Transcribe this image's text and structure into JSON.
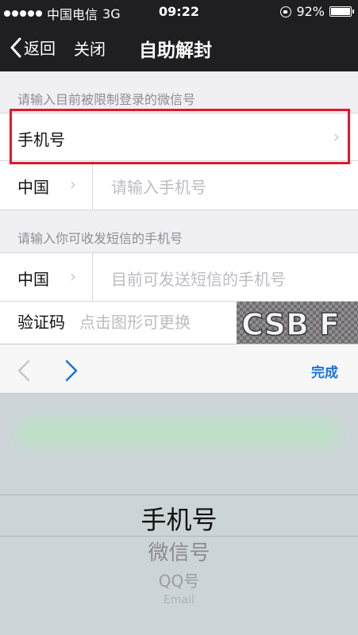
{
  "status_bar": {
    "carrier": "中国电信",
    "network": "3G",
    "time": "09:22",
    "battery": "92%",
    "battery_level": 0.92
  },
  "nav": {
    "back_label": "返回",
    "close_label": "关闭",
    "title": "自助解封"
  },
  "section1": {
    "header": "请输入目前被限制登录的微信号",
    "account_type": "手机号",
    "country": "中国",
    "phone_placeholder": "请输入手机号"
  },
  "section2": {
    "header": "请输入你可收发短信的手机号",
    "country": "中国",
    "phone_placeholder": "目前可发送短信的手机号",
    "captcha_label": "验证码",
    "captcha_placeholder": "点击图形可更换",
    "captcha_text": "CSB F"
  },
  "toolbar": {
    "done_label": "完成"
  },
  "picker": {
    "options": [
      "手机号",
      "微信号",
      "QQ号",
      "Email"
    ],
    "selected": "手机号"
  },
  "colors": {
    "highlight": "#e0182a",
    "accent": "#1a73d9"
  }
}
